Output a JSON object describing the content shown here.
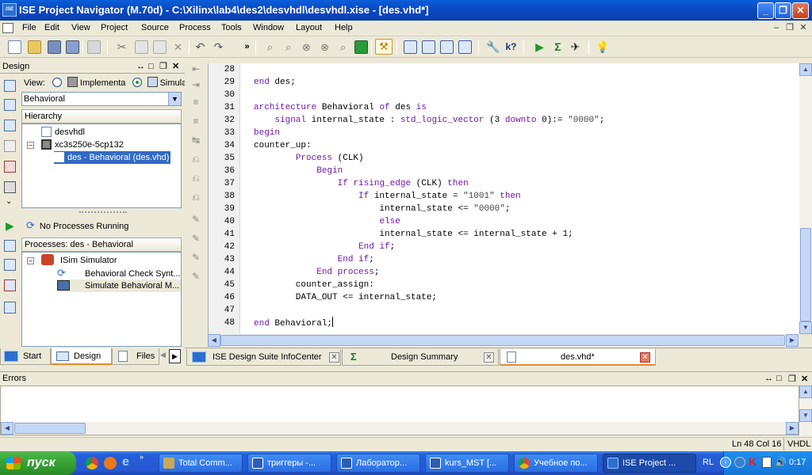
{
  "window": {
    "title": "ISE Project Navigator (M.70d) - C:\\Xilinx\\lab4\\des2\\desvhdl\\desvhdl.xise - [des.vhd*]",
    "app_icon_text": "ISE"
  },
  "menu": {
    "items": [
      "File",
      "Edit",
      "View",
      "Project",
      "Source",
      "Process",
      "Tools",
      "Window",
      "Layout",
      "Help"
    ]
  },
  "design_panel": {
    "title": "Design",
    "view_label": "View:",
    "view_option_impl": "Implementa",
    "view_option_sim": "Simulati",
    "view_selected": "simulation",
    "dropdown_value": "Behavioral",
    "hierarchy_label": "Hierarchy",
    "tree": [
      {
        "label": "desvhdl",
        "icon": "document-icon"
      },
      {
        "label": "xc3s250e-5cp132",
        "icon": "chip-icon"
      },
      {
        "label": "des - Behavioral (des.vhd)",
        "icon": "vhdl-file-icon",
        "selected": true
      }
    ]
  },
  "processes_panel": {
    "status": "No Processes Running",
    "header": "Processes: des - Behavioral",
    "tree": [
      {
        "label": "ISim Simulator",
        "icon": "isim-icon"
      },
      {
        "label": "Behavioral Check Synt...",
        "icon": "refresh-icon"
      },
      {
        "label": "Simulate Behavioral M...",
        "icon": "simulate-icon",
        "selected": true
      }
    ]
  },
  "left_tabs": [
    "Start",
    "Design",
    "Files"
  ],
  "editor": {
    "line_numbers": [
      "28",
      "29",
      "30",
      "31",
      "32",
      "33",
      "34",
      "35",
      "36",
      "37",
      "38",
      "39",
      "40",
      "41",
      "42",
      "43",
      "44",
      "45",
      "46",
      "47",
      "48"
    ],
    "lines": [
      [],
      [
        {
          "t": "end",
          "k": 1
        },
        {
          "t": " des;"
        }
      ],
      [],
      [
        {
          "t": "architecture",
          "k": 1
        },
        {
          "t": " Behavioral "
        },
        {
          "t": "of",
          "k": 1
        },
        {
          "t": " des "
        },
        {
          "t": "is",
          "k": 1
        }
      ],
      [
        {
          "t": "    "
        },
        {
          "t": "signal",
          "k": 1
        },
        {
          "t": " internal_state : "
        },
        {
          "t": "std_logic_vector",
          "k": 1
        },
        {
          "t": " (3 "
        },
        {
          "t": "downto",
          "k": 1
        },
        {
          "t": " 0):= "
        },
        {
          "t": "\"0000\"",
          "s": 1
        },
        {
          "t": ";"
        }
      ],
      [
        {
          "t": "begin",
          "k": 1
        }
      ],
      [
        {
          "t": "counter_up:"
        }
      ],
      [
        {
          "t": "        "
        },
        {
          "t": "Process",
          "k": 1
        },
        {
          "t": " (CLK)"
        }
      ],
      [
        {
          "t": "            "
        },
        {
          "t": "Begin",
          "k": 1
        }
      ],
      [
        {
          "t": "                "
        },
        {
          "t": "If",
          "k": 1
        },
        {
          "t": " "
        },
        {
          "t": "rising_edge",
          "k": 1
        },
        {
          "t": " (CLK) "
        },
        {
          "t": "then",
          "k": 1
        }
      ],
      [
        {
          "t": "                    "
        },
        {
          "t": "If",
          "k": 1
        },
        {
          "t": " internal_state = "
        },
        {
          "t": "\"1001\"",
          "s": 1
        },
        {
          "t": " "
        },
        {
          "t": "then",
          "k": 1
        }
      ],
      [
        {
          "t": "                        internal_state <= "
        },
        {
          "t": "\"0000\"",
          "s": 1
        },
        {
          "t": ";"
        }
      ],
      [
        {
          "t": "                        "
        },
        {
          "t": "else",
          "k": 1
        }
      ],
      [
        {
          "t": "                        internal_state <= internal_state + 1;"
        }
      ],
      [
        {
          "t": "                    "
        },
        {
          "t": "End",
          "k": 1
        },
        {
          "t": " "
        },
        {
          "t": "if",
          "k": 1
        },
        {
          "t": ";"
        }
      ],
      [
        {
          "t": "                "
        },
        {
          "t": "End",
          "k": 1
        },
        {
          "t": " "
        },
        {
          "t": "if",
          "k": 1
        },
        {
          "t": ";"
        }
      ],
      [
        {
          "t": "            "
        },
        {
          "t": "End",
          "k": 1
        },
        {
          "t": " "
        },
        {
          "t": "process",
          "k": 1
        },
        {
          "t": ";"
        }
      ],
      [
        {
          "t": "        counter_assign:"
        }
      ],
      [
        {
          "t": "        DATA_OUT <= internal_state;"
        }
      ],
      [],
      [
        {
          "t": "end",
          "k": 1
        },
        {
          "t": " Behavioral;"
        }
      ]
    ]
  },
  "doc_tabs": [
    {
      "label": "ISE Design Suite InfoCenter",
      "icon": "ise-icon"
    },
    {
      "label": "Design Summary",
      "icon": "sigma-icon"
    },
    {
      "label": "des.vhd*",
      "icon": "document-icon",
      "active": true
    }
  ],
  "errors_panel": {
    "title": "Errors"
  },
  "status_bar": {
    "position": "Ln 48 Col 16",
    "language": "VHDL"
  },
  "taskbar": {
    "start_label": "пуск",
    "buttons": [
      "Total Comm...",
      "триггеры -...",
      "Лаборатор...",
      "kurs_MST [...",
      "Учебное по...",
      "ISE Project ..."
    ],
    "active_button": 5,
    "lang": "RL",
    "clock": "0:17"
  },
  "colors": {
    "keyword": "#6e17a8",
    "titlebar": "#0a4bc4",
    "taskbar": "#245ed8",
    "start": "#37a233"
  }
}
